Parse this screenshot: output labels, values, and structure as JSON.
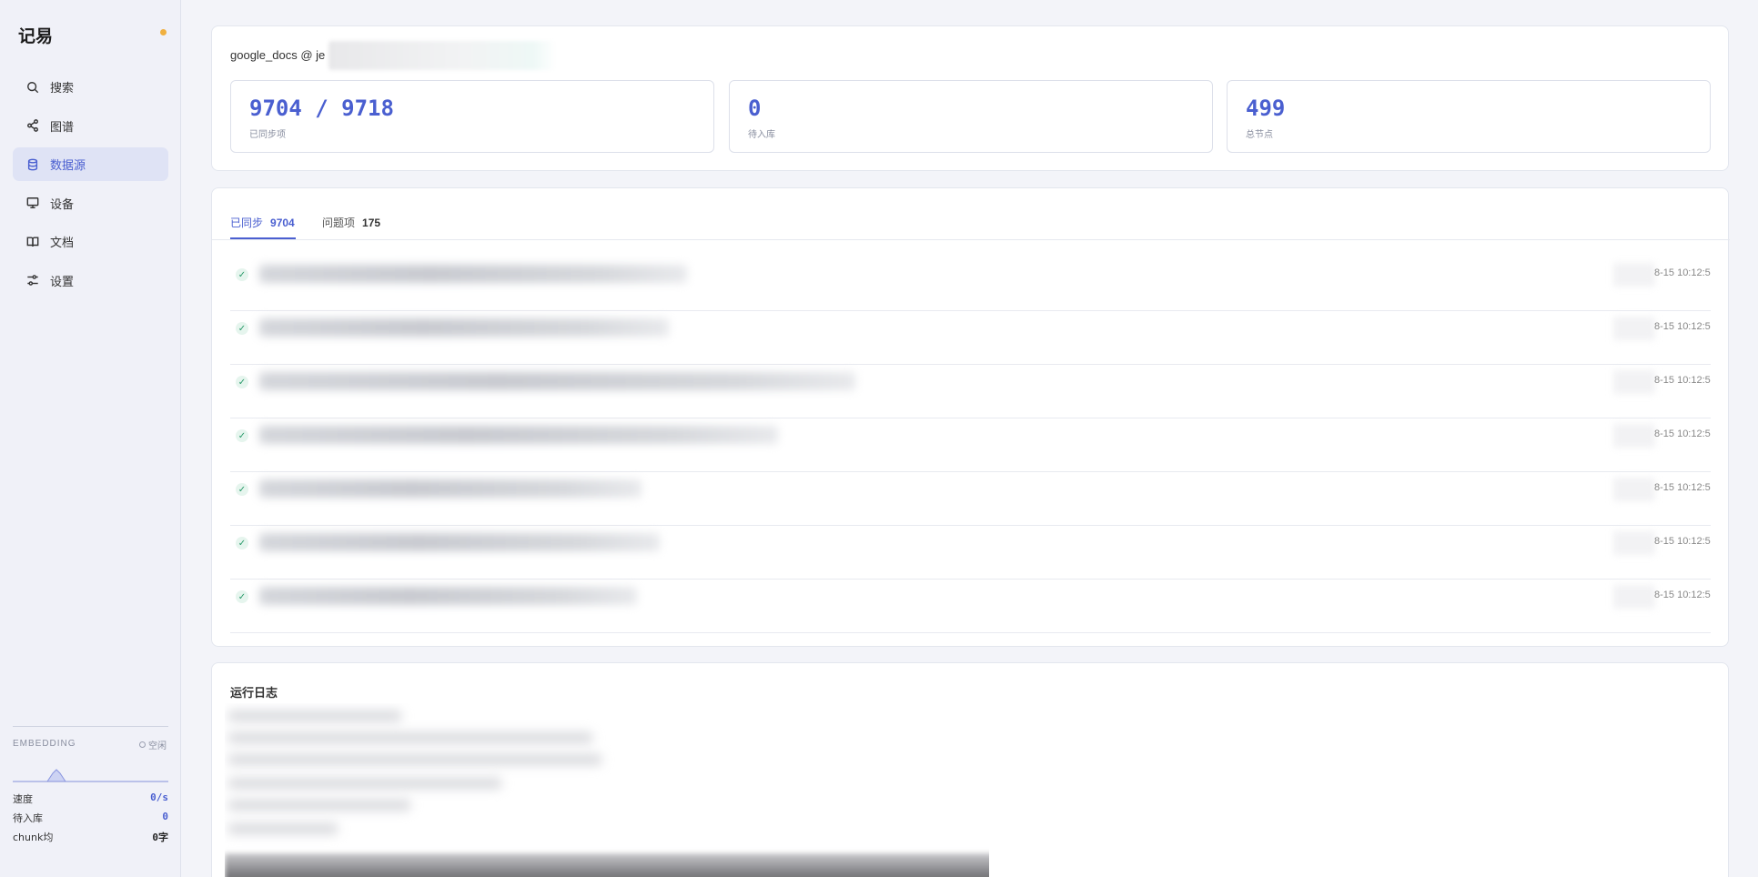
{
  "app": {
    "name": "记易"
  },
  "sidebar": {
    "items": [
      {
        "label": "搜索",
        "icon": "search-icon",
        "active": false
      },
      {
        "label": "图谱",
        "icon": "graph-share-icon",
        "active": false
      },
      {
        "label": "数据源",
        "icon": "database-icon",
        "active": true
      },
      {
        "label": "设备",
        "icon": "monitor-icon",
        "active": false
      },
      {
        "label": "文档",
        "icon": "book-icon",
        "active": false
      },
      {
        "label": "设置",
        "icon": "sliders-icon",
        "active": false
      }
    ],
    "embedding": {
      "label": "EMBEDDING",
      "status": "空闲",
      "stats": [
        {
          "key": "速度",
          "value": "0/s"
        },
        {
          "key": "待入库",
          "value": "0"
        },
        {
          "key": "chunk均",
          "value": "0字"
        }
      ]
    }
  },
  "source": {
    "title": "google_docs @ je",
    "metrics": [
      {
        "value": "9704 / 9718",
        "label": "已同步项"
      },
      {
        "value": "0",
        "label": "待入库"
      },
      {
        "value": "499",
        "label": "总节点"
      }
    ]
  },
  "sync": {
    "tabs": [
      {
        "label": "已同步",
        "count": "9704",
        "active": true
      },
      {
        "label": "问题项",
        "count": "175",
        "active": false
      }
    ],
    "rows": [
      {
        "status": "✓",
        "time": "8-15 10:12:5"
      },
      {
        "status": "✓",
        "time": "8-15 10:12:5"
      },
      {
        "status": "✓",
        "time": "8-15 10:12:5"
      },
      {
        "status": "✓",
        "time": "8-15 10:12:5"
      },
      {
        "status": "✓",
        "time": "8-15 10:12:5"
      },
      {
        "status": "✓",
        "time": "8-15 10:12:5"
      },
      {
        "status": "✓",
        "time": "8-15 10:12:5"
      }
    ]
  },
  "log": {
    "title": "运行日志"
  },
  "colors": {
    "accent": "#4a5fd0",
    "success": "#2a9a6a",
    "brand_dot": "#f0b040"
  }
}
